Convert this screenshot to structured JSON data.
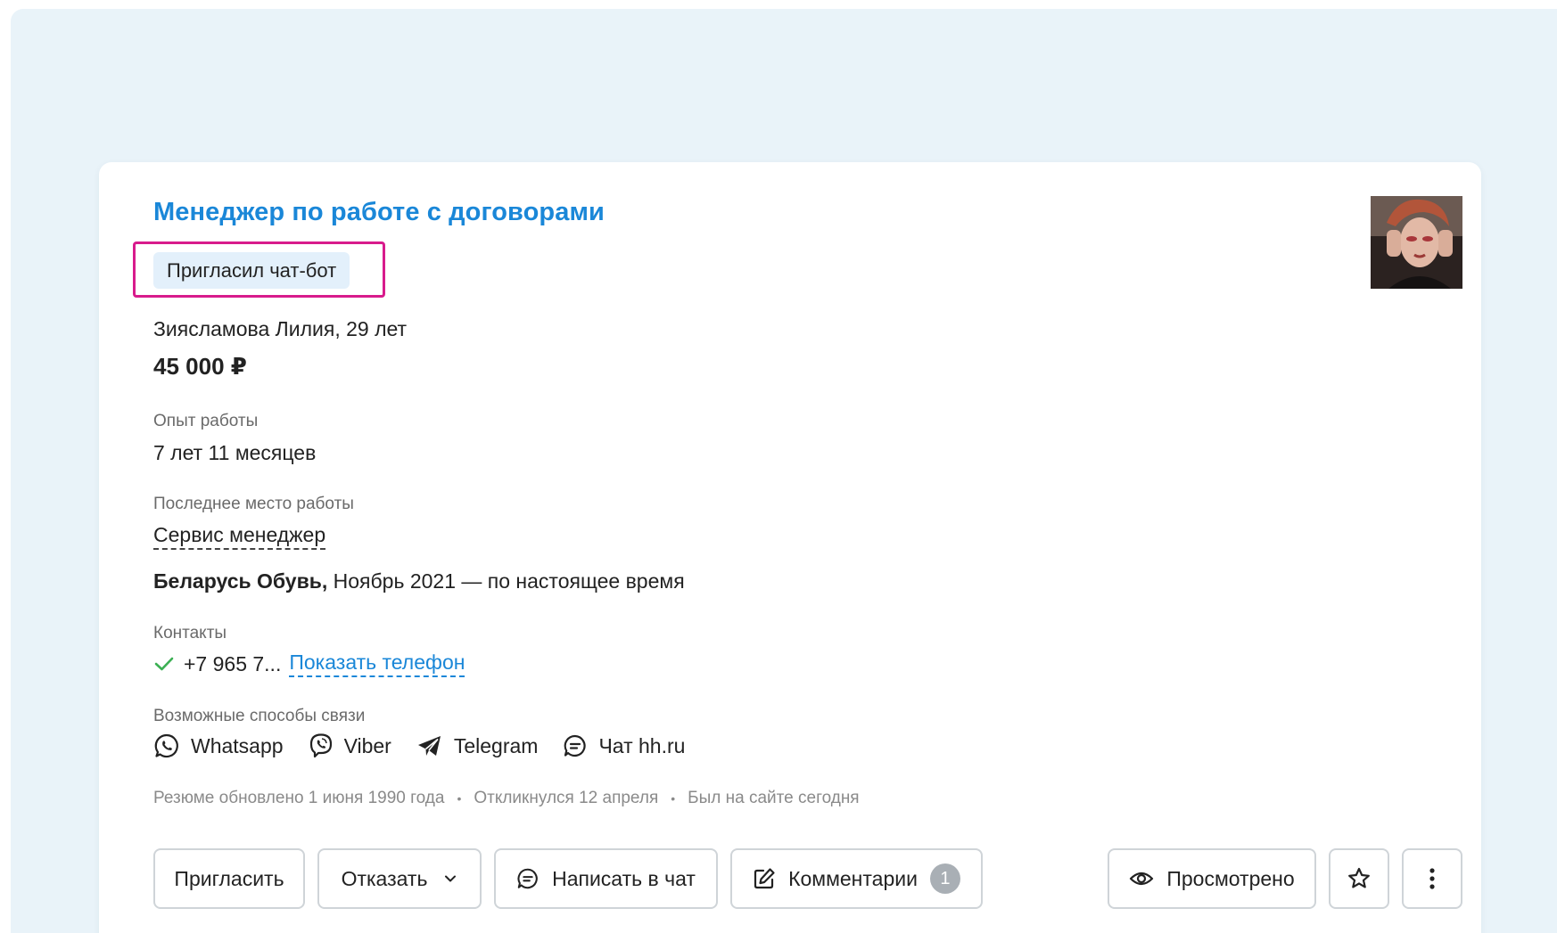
{
  "card": {
    "title": "Менеджер по работе с договорами",
    "badge": "Пригласил чат-бот",
    "name_age": "Зиясламова Лилия, 29 лет",
    "salary": "45 000 ₽",
    "experience": {
      "label": "Опыт работы",
      "value": "7 лет 11 месяцев"
    },
    "last_job": {
      "label": "Последнее место работы",
      "position": "Сервис менеджер",
      "company": "Беларусь Обувь,",
      "period": " Ноябрь 2021 — по настоящее время"
    },
    "contacts": {
      "label": "Контакты",
      "phone": "+7 965 7...",
      "show_phone": "Показать телефон"
    },
    "methods": {
      "label": "Возможные способы связи",
      "items": [
        "Whatsapp",
        "Viber",
        "Telegram",
        "Чат hh.ru"
      ]
    },
    "meta": {
      "updated": "Резюме обновлено 1 июня 1990 года",
      "responded": "Откликнулся 12 апреля",
      "seen": "Был на сайте сегодня"
    }
  },
  "actions": {
    "invite": "Пригласить",
    "reject": "Отказать",
    "chat": "Написать в чат",
    "comments": "Комментарии",
    "comments_count": "1",
    "viewed": "Просмотрено"
  },
  "colors": {
    "accent": "#1a87d8",
    "highlight": "#d81b8c",
    "badge_bg": "#e3f0fb",
    "page_bg": "#e9f3f9",
    "check": "#3cb054"
  },
  "icons": [
    "check-icon",
    "whatsapp-icon",
    "viber-icon",
    "telegram-icon",
    "chat-icon",
    "chevron-down-icon",
    "edit-icon",
    "eye-icon",
    "star-icon",
    "more-icon"
  ]
}
